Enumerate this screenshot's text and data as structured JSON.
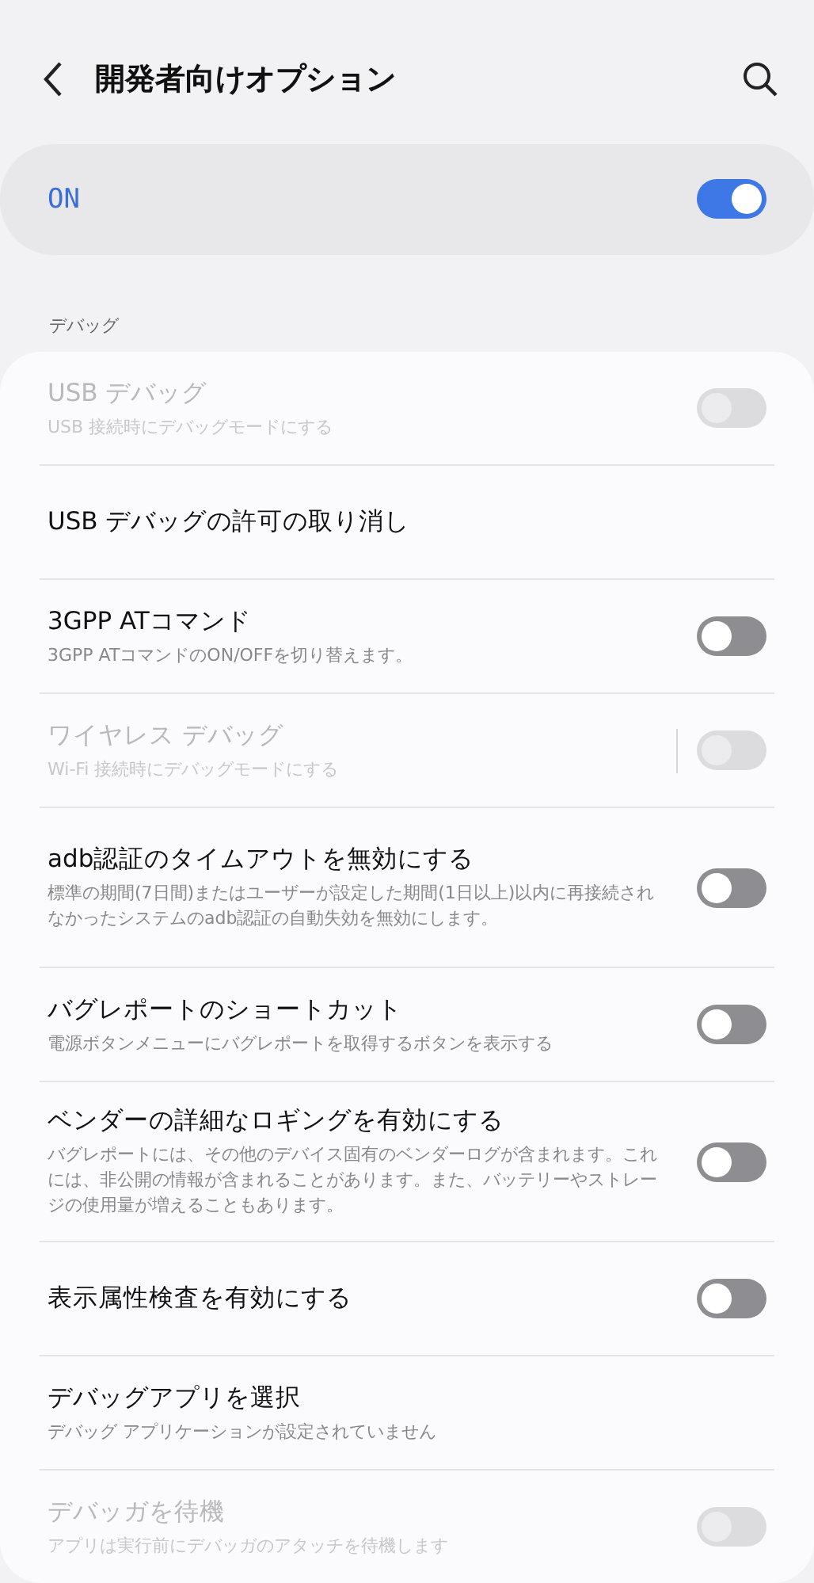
{
  "header": {
    "title": "開発者向けオプション"
  },
  "master": {
    "label": "ON",
    "on": true
  },
  "section": {
    "title": "デバッグ"
  },
  "rows": [
    {
      "kind": "switch",
      "title": "USB デバッグ",
      "summary": "USB 接続時にデバッグモードにする",
      "on": false,
      "disabled": true
    },
    {
      "kind": "action",
      "title": "USB デバッグの許可の取り消し",
      "disabled": false
    },
    {
      "kind": "switch",
      "title": "3GPP ATコマンド",
      "summary": "3GPP ATコマンドのON/OFFを切り替えます。",
      "on": false,
      "disabled": false
    },
    {
      "kind": "split-switch",
      "title": "ワイヤレス デバッグ",
      "summary": "Wi-Fi 接続時にデバッグモードにする",
      "on": false,
      "disabled": true
    },
    {
      "kind": "switch",
      "title": "adb認証のタイムアウトを無効にする",
      "summary": "標準の期間(7日間)またはユーザーが設定した期間(1日以上)以内に再接続されなかったシステムのadb認証の自動失効を無効にします。",
      "on": false,
      "disabled": false
    },
    {
      "kind": "switch",
      "title": "バグレポートのショートカット",
      "summary": "電源ボタンメニューにバグレポートを取得するボタンを表示する",
      "on": false,
      "disabled": false
    },
    {
      "kind": "switch",
      "title": "ベンダーの詳細なロギングを有効にする",
      "summary": "バグレポートには、その他のデバイス固有のベンダーログが含まれます。これには、非公開の情報が含まれることがあります。また、バッテリーやストレージの使用量が増えることもあります。",
      "on": false,
      "disabled": false
    },
    {
      "kind": "switch",
      "title": "表示属性検査を有効にする",
      "on": false,
      "disabled": false
    },
    {
      "kind": "action",
      "title": "デバッグアプリを選択",
      "summary": "デバッグ アプリケーションが設定されていません",
      "disabled": false
    },
    {
      "kind": "switch",
      "title": "デバッガを待機",
      "summary": "アプリは実行前にデバッガのアタッチを待機します",
      "on": false,
      "disabled": true
    }
  ]
}
